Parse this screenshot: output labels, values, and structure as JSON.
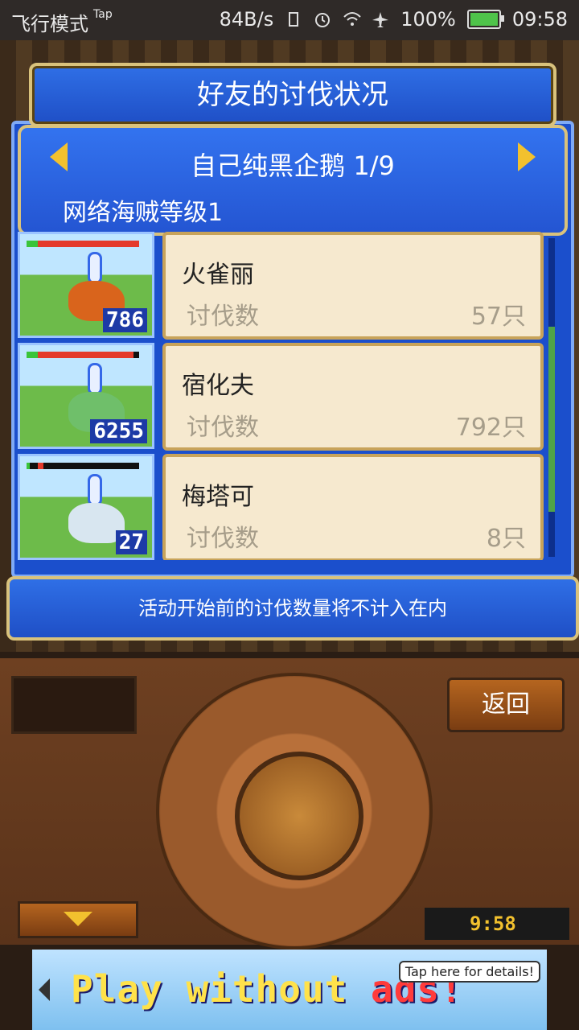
{
  "status_bar": {
    "mode": "飞行模式",
    "tap": "Tap",
    "speed": "84B/s",
    "battery": "100%",
    "time": "09:58"
  },
  "dialog": {
    "title": "好友的讨伐状况",
    "friend_name": "自己纯黑企鹅 1/9",
    "level": "网络海贼等级1",
    "notice": "活动开始前的讨伐数量将不计入在内"
  },
  "list": [
    {
      "name": "火雀丽",
      "label": "讨伐数",
      "value": "57只",
      "badge": "786",
      "hp": 0.9,
      "color": "#d9641c"
    },
    {
      "name": "宿化夫",
      "label": "讨伐数",
      "value": "792只",
      "badge": "6255",
      "hp": 0.85,
      "color": "#6fbf6a"
    },
    {
      "name": "梅塔可",
      "label": "讨伐数",
      "value": "8只",
      "badge": "27",
      "hp": 0.05,
      "color": "#d8e6f0"
    }
  ],
  "controller": {
    "back_label": "返回",
    "clock": "9:58"
  },
  "ad": {
    "text_main": "Play without ",
    "text_red": "ads!",
    "tap_text": "Tap here for details!"
  }
}
